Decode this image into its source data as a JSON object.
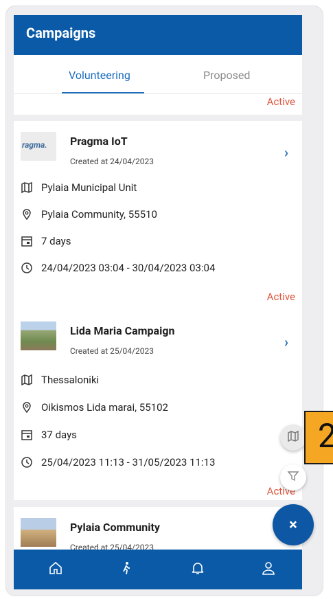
{
  "app_bar": {
    "title": "Campaigns"
  },
  "tabs": [
    {
      "label": "Volunteering",
      "active": true
    },
    {
      "label": "Proposed",
      "active": false
    }
  ],
  "partial_card": {
    "status": "Active"
  },
  "cards": [
    {
      "title": "Pragma IoT",
      "created": "Created at 24/04/2023",
      "thumb_text": "ragma.",
      "location": "Pylaia Municipal Unit",
      "address": "Pylaia Community, 55510",
      "duration": "7 days",
      "period": "24/04/2023 03:04 - 30/04/2023 03:04",
      "status": "Active"
    },
    {
      "title": "Lida Maria Campaign",
      "created": "Created at 25/04/2023",
      "location": "Thessaloniki",
      "address": "Oikismos Lida marai, 55102",
      "duration": "37 days",
      "period": "25/04/2023 11:13 - 31/05/2023 11:13",
      "status": "Active"
    },
    {
      "title": "Pylaia Community",
      "created": "Created at 25/04/2023"
    }
  ],
  "fab": {
    "close_label": "×"
  },
  "callout": {
    "number": "2"
  },
  "bottom_nav": [
    "home-icon",
    "walk-icon",
    "bell-icon",
    "user-icon"
  ],
  "colors": {
    "primary": "#0a5aa8",
    "accent": "#1a6cc0",
    "status_active": "#e0553c",
    "callout": "#f5a623"
  }
}
